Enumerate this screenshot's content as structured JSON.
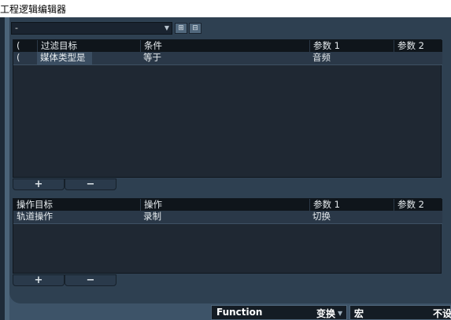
{
  "window": {
    "title": "工程逻辑编辑器"
  },
  "toolbar": {
    "preset_value": "-",
    "btn1_icon": "add-preset-icon",
    "btn2_icon": "remove-preset-icon"
  },
  "filter": {
    "headers": [
      "(",
      "过滤目标",
      "条件",
      "参数 1",
      "参数 2"
    ],
    "rows": [
      [
        "(",
        "媒体类型是",
        "等于",
        "音频",
        ""
      ]
    ]
  },
  "filter_buttons": {
    "add": "+",
    "remove": "−"
  },
  "action": {
    "headers": [
      "操作目标",
      "操作",
      "参数 1",
      "参数 2"
    ],
    "rows": [
      [
        "轨道操作",
        "录制",
        "切换",
        ""
      ]
    ]
  },
  "action_buttons": {
    "add": "+",
    "remove": "−"
  },
  "bottom": {
    "function_label": "Function",
    "function_value": "变换",
    "macro_label": "宏",
    "macro_value": "不设"
  }
}
